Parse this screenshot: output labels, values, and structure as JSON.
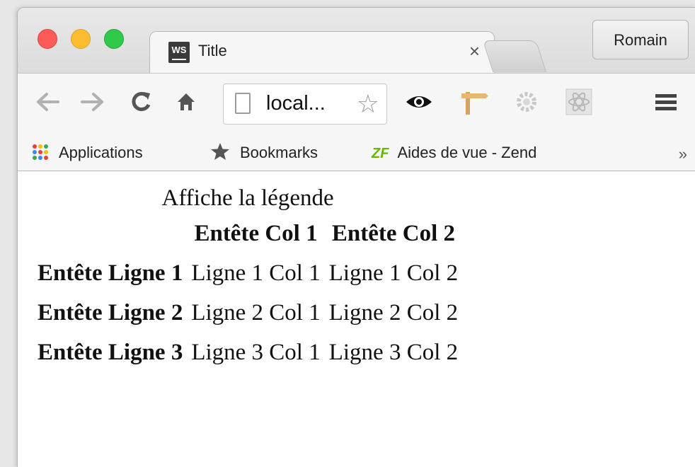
{
  "tab": {
    "favicon_text": "WS",
    "title": "Title",
    "close_glyph": "×"
  },
  "profile": {
    "name": "Romain"
  },
  "toolbar": {
    "back_icon": "arrow-left",
    "forward_icon": "arrow-right",
    "reload_icon": "reload",
    "home_icon": "home",
    "url": "local...",
    "extensions": [
      "eye-icon",
      "signpost-icon",
      "gear-icon",
      "atom-icon"
    ],
    "menu_icon": "hamburger"
  },
  "bookmarks": {
    "items": [
      {
        "label": "Applications",
        "icon": "apps-grid-icon"
      },
      {
        "label": "Bookmarks",
        "icon": "star-icon"
      },
      {
        "label": "Aides de vue - Zend",
        "icon": "zf-icon",
        "icon_text": "ZF"
      }
    ],
    "more": "»"
  },
  "table": {
    "caption": "Affiche la légende",
    "col_headers": [
      "Entête Col 1",
      "Entête Col 2"
    ],
    "rows": [
      {
        "header": "Entête Ligne 1",
        "cells": [
          "Ligne 1 Col 1",
          "Ligne 1 Col 2"
        ]
      },
      {
        "header": "Entête Ligne 2",
        "cells": [
          "Ligne 2 Col 1",
          "Ligne 2 Col 2"
        ]
      },
      {
        "header": "Entête Ligne 3",
        "cells": [
          "Ligne 3 Col 1",
          "Ligne 3 Col 2"
        ]
      }
    ]
  },
  "colors": {
    "close": "#fc5b57",
    "minimize": "#fdbd2e",
    "zoom": "#30c94a",
    "zf_green": "#68b604"
  }
}
